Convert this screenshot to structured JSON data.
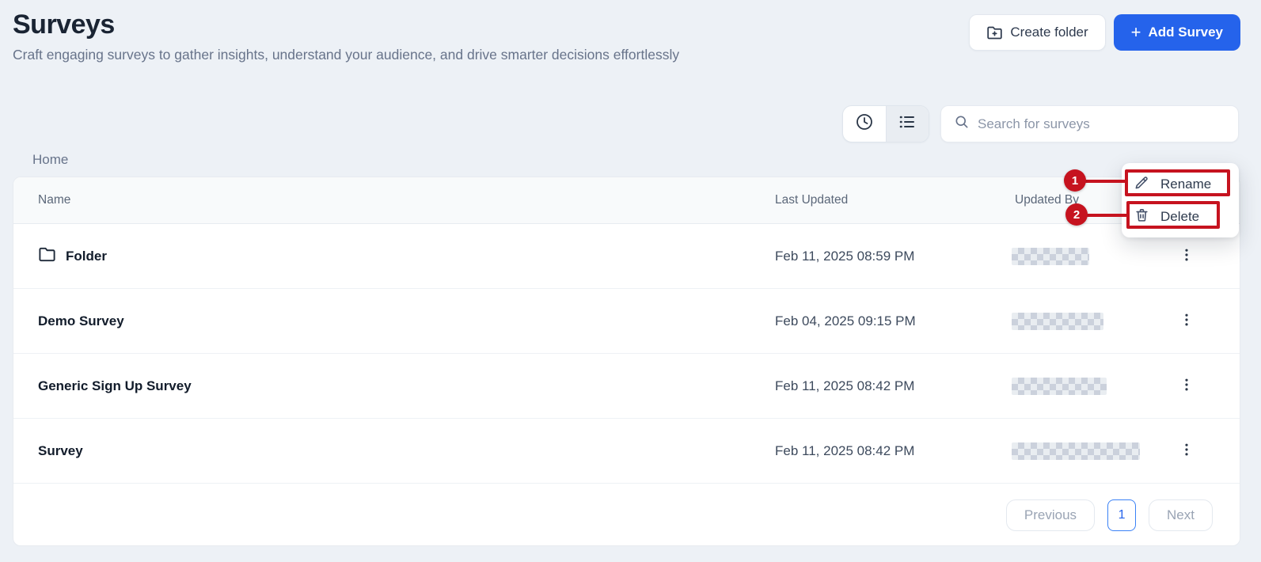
{
  "page": {
    "title": "Surveys",
    "subtitle": "Craft engaging surveys to gather insights, understand your audience, and drive smarter decisions effortlessly"
  },
  "header_actions": {
    "create_folder_label": "Create folder",
    "add_survey_label": "Add Survey",
    "add_survey_plus": "+"
  },
  "toolbar": {
    "search_placeholder": "Search for surveys",
    "view_toggles": [
      "clock-icon",
      "list-icon"
    ]
  },
  "breadcrumb": {
    "home": "Home"
  },
  "table": {
    "columns": {
      "name": "Name",
      "last_updated": "Last Updated",
      "updated_by": "Updated By"
    },
    "rows": [
      {
        "name": "Folder",
        "type": "folder",
        "last_updated": "Feb 11, 2025 08:59 PM",
        "updated_by": "(redacted/blurred)"
      },
      {
        "name": "Demo Survey",
        "type": "survey",
        "last_updated": "Feb 04, 2025 09:15 PM",
        "updated_by": "(redacted/blurred)"
      },
      {
        "name": "Generic Sign Up Survey",
        "type": "survey",
        "last_updated": "Feb 11, 2025 08:42 PM",
        "updated_by": "(redacted/blurred)"
      },
      {
        "name": "Survey",
        "type": "survey",
        "last_updated": "Feb 11, 2025 08:42 PM",
        "updated_by": "(redacted/blurred)"
      }
    ]
  },
  "pagination": {
    "previous": "Previous",
    "page": "1",
    "next": "Next"
  },
  "context_menu": {
    "items": [
      {
        "label": "Rename",
        "icon": "pencil-icon"
      },
      {
        "label": "Delete",
        "icon": "trash-icon"
      }
    ]
  },
  "annotations": {
    "steps": [
      {
        "number": "1",
        "target": "Rename"
      },
      {
        "number": "2",
        "target": "Delete"
      }
    ]
  },
  "colors": {
    "primary_blue": "#2563eb",
    "annotation_red": "#c6131f",
    "page_background": "#edf1f6",
    "pagination_active_border": "#3b82f6"
  }
}
